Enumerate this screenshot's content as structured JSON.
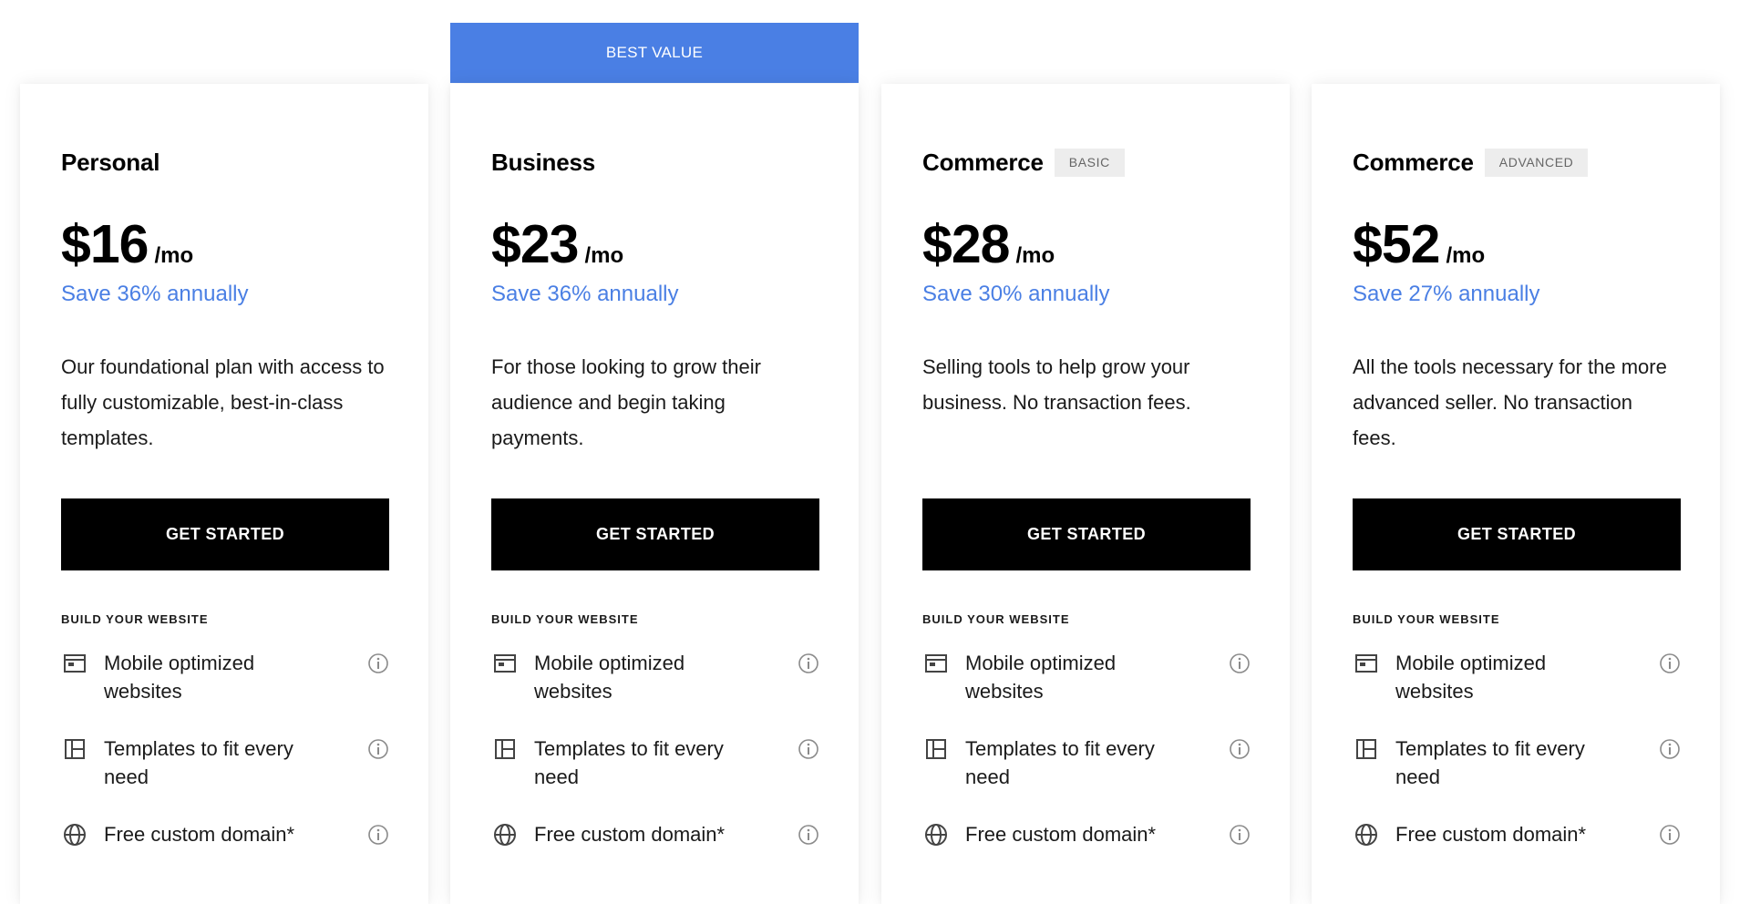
{
  "banner": {
    "label": "BEST VALUE"
  },
  "colors": {
    "accent": "#4a7fe4",
    "cta_background": "#000000",
    "badge_background": "#ededed",
    "badge_text": "#666666"
  },
  "plans": [
    {
      "name": "Personal",
      "badge": "",
      "price": "$16",
      "period": "/mo",
      "savings": "Save 36% annually",
      "description": "Our foundational plan with access to fully customizable, best-in-class templates.",
      "cta": "GET STARTED",
      "section": "BUILD YOUR WEBSITE",
      "features": [
        {
          "label": "Mobile optimized websites",
          "icon": "layout-icon"
        },
        {
          "label": "Templates to fit every need",
          "icon": "template-icon"
        },
        {
          "label": "Free custom domain*",
          "icon": "globe-icon"
        }
      ]
    },
    {
      "name": "Business",
      "badge": "",
      "price": "$23",
      "period": "/mo",
      "savings": "Save 36% annually",
      "description": "For those looking to grow their audience and begin taking payments.",
      "cta": "GET STARTED",
      "section": "BUILD YOUR WEBSITE",
      "features": [
        {
          "label": "Mobile optimized websites",
          "icon": "layout-icon"
        },
        {
          "label": "Templates to fit every need",
          "icon": "template-icon"
        },
        {
          "label": "Free custom domain*",
          "icon": "globe-icon"
        }
      ]
    },
    {
      "name": "Commerce",
      "badge": "BASIC",
      "price": "$28",
      "period": "/mo",
      "savings": "Save 30% annually",
      "description": "Selling tools to help grow your business. No transaction fees.",
      "cta": "GET STARTED",
      "section": "BUILD YOUR WEBSITE",
      "features": [
        {
          "label": "Mobile optimized websites",
          "icon": "layout-icon"
        },
        {
          "label": "Templates to fit every need",
          "icon": "template-icon"
        },
        {
          "label": "Free custom domain*",
          "icon": "globe-icon"
        }
      ]
    },
    {
      "name": "Commerce",
      "badge": "ADVANCED",
      "price": "$52",
      "period": "/mo",
      "savings": "Save 27% annually",
      "description": "All the tools necessary for the more advanced seller. No transaction fees.",
      "cta": "GET STARTED",
      "section": "BUILD YOUR WEBSITE",
      "features": [
        {
          "label": "Mobile optimized websites",
          "icon": "layout-icon"
        },
        {
          "label": "Templates to fit every need",
          "icon": "template-icon"
        },
        {
          "label": "Free custom domain*",
          "icon": "globe-icon"
        }
      ]
    }
  ]
}
